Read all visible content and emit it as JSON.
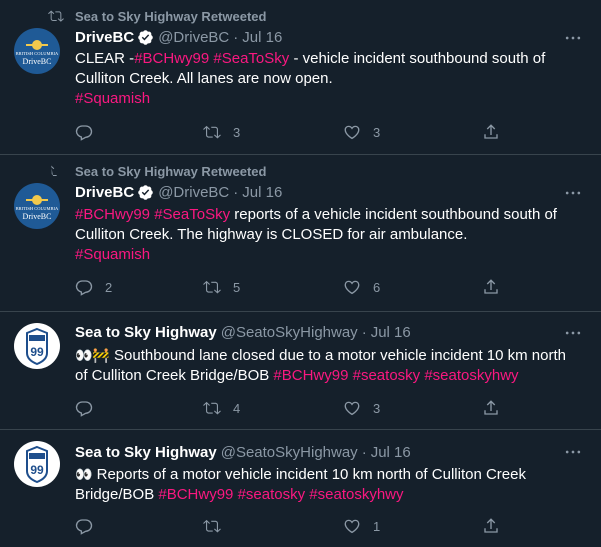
{
  "colors": {
    "background": "#15202b",
    "divider": "#38444d",
    "muted": "#8b98a5",
    "hashtag": "#f91880",
    "verified": "#ffffff"
  },
  "tweets": [
    {
      "retweet_label": "Sea to Sky Highway Retweeted",
      "avatar": "drivebc-logo",
      "avatar_text_top": "BRITISH COLUMBIA",
      "avatar_text_bottom": "DriveBC",
      "name": "DriveBC",
      "verified": true,
      "handle": "@DriveBC",
      "dot": "·",
      "date": "Jul 16",
      "text_parts": [
        "CLEAR -",
        "#BCHwy99",
        " ",
        "#SeaToSky",
        " - vehicle incident southbound south of Culliton Creek.  All lanes are now open.",
        "#Squamish"
      ],
      "reply_count": "",
      "retweet_count": "3",
      "like_count": "3"
    },
    {
      "retweet_label": "Sea to Sky Highway Retweeted",
      "avatar": "drivebc-logo",
      "avatar_text_top": "BRITISH COLUMBIA",
      "avatar_text_bottom": "DriveBC",
      "name": "DriveBC",
      "verified": true,
      "handle": "@DriveBC",
      "dot": "·",
      "date": "Jul 16",
      "text_parts": [
        "#BCHwy99",
        " ",
        "#SeaToSky",
        " reports of a vehicle incident southbound south of Culliton Creek. The highway is CLOSED for air ambulance.",
        "#Squamish"
      ],
      "reply_count": "2",
      "retweet_count": "5",
      "like_count": "6"
    },
    {
      "avatar": "highway-99-shield",
      "avatar_number": "99",
      "name": "Sea to Sky Highway",
      "handle": "@SeatoSkyHighway",
      "dot": "·",
      "date": "Jul 16",
      "emoji": "👀🚧",
      "text_parts": [
        " Southbound lane closed due to a motor vehicle incident 10 km north of Culliton Creek Bridge/BOB ",
        "#BCHwy99",
        " ",
        "#seatosky",
        " ",
        "#seatoskyhwy"
      ],
      "reply_count": "",
      "retweet_count": "4",
      "like_count": "3"
    },
    {
      "avatar": "highway-99-shield",
      "avatar_number": "99",
      "name": "Sea to Sky Highway",
      "handle": "@SeatoSkyHighway",
      "dot": "·",
      "date": "Jul 16",
      "emoji": "👀",
      "text_parts": [
        " Reports of a motor vehicle incident 10 km north of Culliton Creek Bridge/BOB ",
        "#BCHwy99",
        " ",
        "#seatosky",
        " ",
        "#seatoskyhwy"
      ],
      "reply_count": "",
      "retweet_count": "",
      "like_count": "1"
    }
  ]
}
